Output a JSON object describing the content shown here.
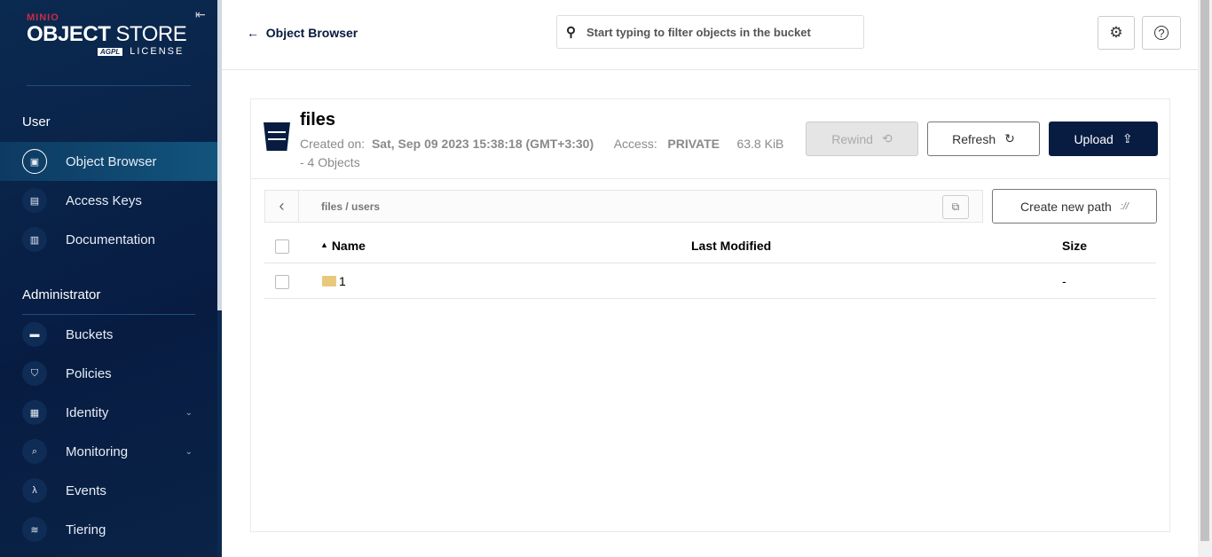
{
  "sidebar": {
    "logo": {
      "brand": "MINIO",
      "product_bold": "OBJECT",
      "product_light": "STORE",
      "license_badge": "AGPL",
      "license": "LICENSE"
    },
    "sections": [
      {
        "label": "User"
      },
      {
        "label": "Administrator"
      }
    ],
    "user_items": [
      {
        "label": "Object Browser",
        "icon": "object-browser-icon",
        "active": true
      },
      {
        "label": "Access Keys",
        "icon": "access-keys-icon"
      },
      {
        "label": "Documentation",
        "icon": "documentation-icon"
      }
    ],
    "admin_items": [
      {
        "label": "Buckets",
        "icon": "bucket-icon"
      },
      {
        "label": "Policies",
        "icon": "policy-icon"
      },
      {
        "label": "Identity",
        "icon": "identity-icon",
        "expandable": true
      },
      {
        "label": "Monitoring",
        "icon": "monitoring-icon",
        "expandable": true
      },
      {
        "label": "Events",
        "icon": "lambda-icon"
      },
      {
        "label": "Tiering",
        "icon": "tiering-icon"
      }
    ]
  },
  "header": {
    "back_label": "Object Browser",
    "search_placeholder": "Start typing to filter objects in the bucket"
  },
  "bucket": {
    "name": "files",
    "created_label": "Created on:",
    "created": "Sat, Sep 09 2023 15:38:18 (GMT+3:30)",
    "access_label": "Access:",
    "access": "PRIVATE",
    "size": "63.8 KiB",
    "objects": "- 4 Objects"
  },
  "actions": {
    "rewind": "Rewind",
    "refresh": "Refresh",
    "upload": "Upload",
    "create_path": "Create new path"
  },
  "breadcrumb": {
    "path": "files / users"
  },
  "table": {
    "columns": [
      "Name",
      "Last Modified",
      "Size"
    ],
    "rows": [
      {
        "name": "1",
        "last_modified": "",
        "size": "-"
      }
    ]
  },
  "colors": {
    "sidebar": "#081c42",
    "primary": "#081c42",
    "brand_red": "#c72c48"
  }
}
